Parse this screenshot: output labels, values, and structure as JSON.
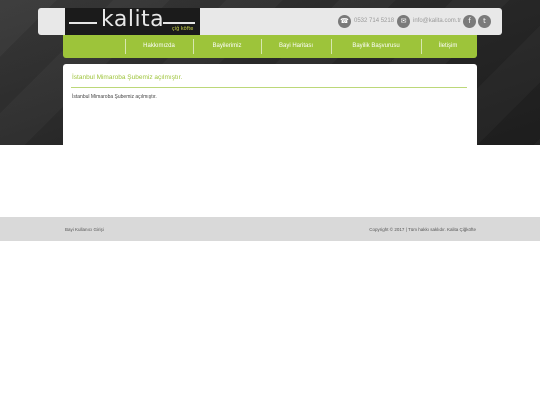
{
  "brand": {
    "name": "kalita",
    "tagline": "çiğ köfte"
  },
  "contact": {
    "phone": "0532 714 5218",
    "email": "info@kalita.com.tr",
    "phone_icon": "phone-icon",
    "email_icon": "mail-icon",
    "social": [
      "facebook-icon",
      "twitter-icon"
    ]
  },
  "nav": {
    "items": [
      {
        "label": "Hakkımızda"
      },
      {
        "label": "Bayilerimiz"
      },
      {
        "label": "Bayi Haritası"
      },
      {
        "label": "Bayilik Başvurusu"
      },
      {
        "label": "İletişim"
      }
    ]
  },
  "content": {
    "title": "İstanbul Mimaroba Şubemiz açılmıştır.",
    "body": "İstanbul Mimaroba Şubemiz açılmıştır."
  },
  "footer": {
    "left": "Bayi Kullanıcı Girişi",
    "right": "Copyright © 2017 | Tüm hakkı saklıdır.  Kalita Çiğköfte"
  },
  "colors": {
    "accent": "#9dc43a",
    "dark": "#1b1b1b",
    "footer_bg": "#d9d9d9"
  }
}
